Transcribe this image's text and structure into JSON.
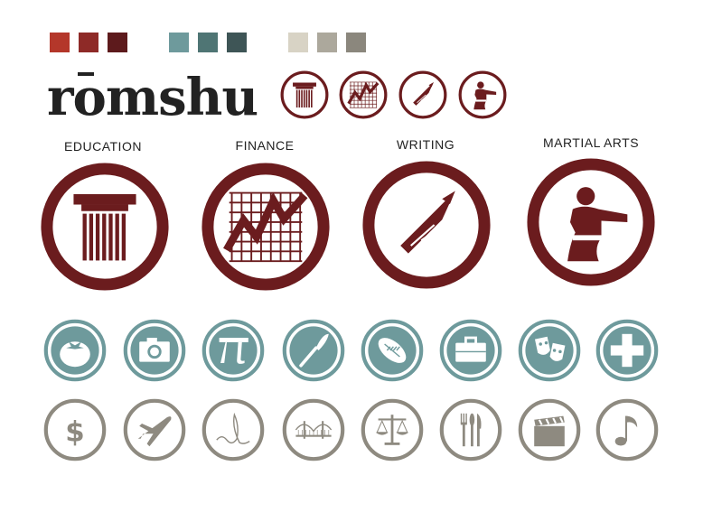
{
  "brand": {
    "name": "romshu",
    "name_display": "rōmshu"
  },
  "palette": {
    "reds": [
      "#b4372a",
      "#8e2a27",
      "#5d1a1c"
    ],
    "teals": [
      "#6e9a9c",
      "#4f7574",
      "#3e5556"
    ],
    "greys": [
      "#d8d3c5",
      "#aca89c",
      "#8b877d"
    ]
  },
  "colors": {
    "maroon": "#6b1c1e",
    "teal": "#6e9a9c",
    "grey": "#8e8a80",
    "white": "#ffffff"
  },
  "categories": [
    {
      "label": "EDUCATION",
      "icon": "column-icon"
    },
    {
      "label": "FINANCE",
      "icon": "chart-icon"
    },
    {
      "label": "WRITING",
      "icon": "pencil-icon"
    },
    {
      "label": "MARTIAL ARTS",
      "icon": "martial-artist-icon"
    }
  ],
  "teal_icons": [
    "tomato-icon",
    "camera-icon",
    "pi-icon",
    "paintbrush-icon",
    "football-icon",
    "briefcase-icon",
    "theater-masks-icon",
    "plus-icon"
  ],
  "grey_icons": [
    "dollar-icon",
    "airplane-icon",
    "handwriting-icon",
    "bridge-icon",
    "scales-icon",
    "utensils-icon",
    "clapperboard-icon",
    "music-note-icon"
  ]
}
